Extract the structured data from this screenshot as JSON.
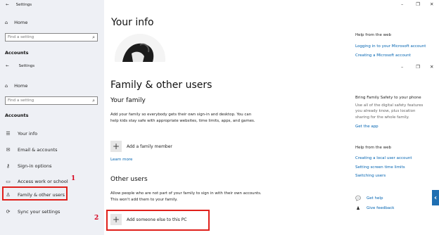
{
  "back_window": {
    "title": "Settings",
    "home_label": "Home",
    "search_placeholder": "Find a setting",
    "section_label": "Accounts",
    "page_title": "Your info",
    "help_title": "Help from the web",
    "links": [
      "Logging in to your Microsoft account",
      "Creating a Microsoft account"
    ]
  },
  "front_window": {
    "title": "Settings",
    "home_label": "Home",
    "search_placeholder": "Find a setting",
    "section_label": "Accounts",
    "nav_items": [
      {
        "label": "Your info",
        "icon": "person-card-icon"
      },
      {
        "label": "Email & accounts",
        "icon": "mail-icon"
      },
      {
        "label": "Sign-in options",
        "icon": "key-icon"
      },
      {
        "label": "Access work or school",
        "icon": "briefcase-icon"
      },
      {
        "label": "Family & other users",
        "icon": "people-icon"
      },
      {
        "label": "Sync your settings",
        "icon": "sync-icon"
      }
    ],
    "page_title": "Family & other users",
    "your_family": {
      "heading": "Your family",
      "description": "Add your family so everybody gets their own sign-in and desktop. You can help kids stay safe with appropriate websites, time limits, apps, and games.",
      "add_label": "Add a family member",
      "learn_more": "Learn more"
    },
    "other_users": {
      "heading": "Other users",
      "description": "Allow people who are not part of your family to sign in with their own accounts. This won't add them to your family.",
      "add_label": "Add someone else to this PC"
    },
    "right": {
      "family_safety_title": "Bring Family Safety to your phone",
      "family_safety_text": "Use all of the digital safety features you already know, plus location sharing for the whole family.",
      "get_app": "Get the app",
      "help_title": "Help from the web",
      "help_links": [
        "Creating a local user account",
        "Setting screen time limits",
        "Switching users"
      ],
      "get_help": "Get help",
      "give_feedback": "Give feedback"
    }
  },
  "annotations": {
    "one": "1",
    "two": "2"
  },
  "colors": {
    "accent": "#0063b1",
    "annotation": "#e0201b",
    "sidebar_bg": "#eef0f5"
  }
}
